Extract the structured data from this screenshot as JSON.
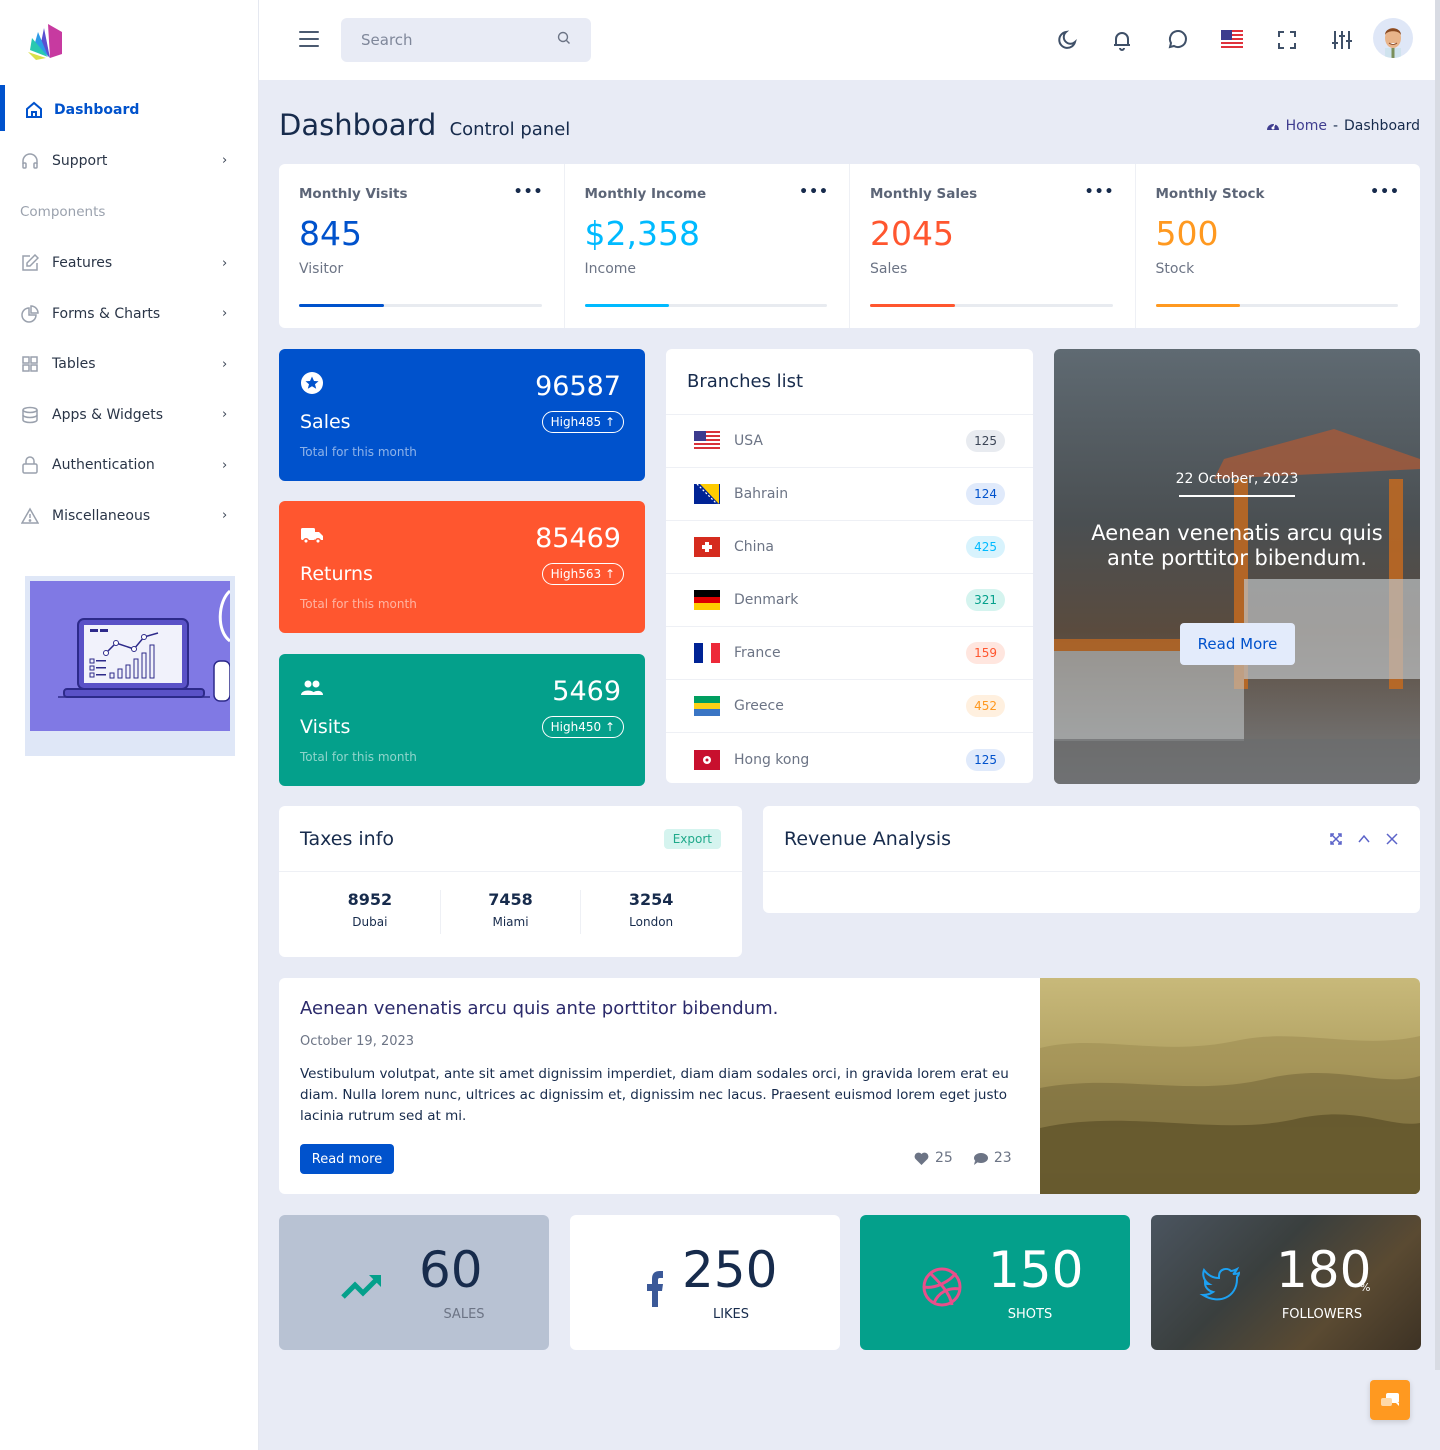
{
  "header": {
    "search_placeholder": "Search"
  },
  "sidebar": {
    "items": [
      {
        "label": "Dashboard",
        "active": true
      },
      {
        "label": "Support"
      },
      {
        "label": "Features"
      },
      {
        "label": "Forms & Charts"
      },
      {
        "label": "Tables"
      },
      {
        "label": "Apps & Widgets"
      },
      {
        "label": "Authentication"
      },
      {
        "label": "Miscellaneous"
      }
    ],
    "section_heading": "Components"
  },
  "page": {
    "title": "Dashboard",
    "subtitle": "Control panel",
    "breadcrumb": {
      "home": "Home",
      "separator": "-",
      "current": "Dashboard"
    }
  },
  "stats": [
    {
      "label": "Monthly Visits",
      "value": "845",
      "sub": "Visitor",
      "color": "#0052cc",
      "progress_pct": 35
    },
    {
      "label": "Monthly Income",
      "value": "$2,358",
      "sub": "Income",
      "color": "#00baff",
      "progress_pct": 35
    },
    {
      "label": "Monthly Sales",
      "value": "2045",
      "sub": "Sales",
      "color": "#ff562f",
      "progress_pct": 35
    },
    {
      "label": "Monthly Stock",
      "value": "500",
      "sub": "Stock",
      "color": "#ff9920",
      "progress_pct": 35
    }
  ],
  "stat_menu": "•••",
  "colored_cards": [
    {
      "title": "Sales",
      "value": "96587",
      "pill": "High485 ↑",
      "sub": "Total for this month",
      "color": "#0052cc"
    },
    {
      "title": "Returns",
      "value": "85469",
      "pill": "High563 ↑",
      "sub": "Total for this month",
      "color": "#ff562f"
    },
    {
      "title": "Visits",
      "value": "5469",
      "pill": "High450 ↑",
      "sub": "Total for this month",
      "color": "#04a08b"
    }
  ],
  "branches": {
    "title": "Branches list",
    "items": [
      {
        "name": "USA",
        "count": "125"
      },
      {
        "name": "Bahrain",
        "count": "124"
      },
      {
        "name": "China",
        "count": "425"
      },
      {
        "name": "Denmark",
        "count": "321"
      },
      {
        "name": "France",
        "count": "159"
      },
      {
        "name": "Greece",
        "count": "452"
      },
      {
        "name": "Hong kong",
        "count": "125"
      }
    ]
  },
  "feature": {
    "date": "22 October, 2023",
    "headline": "Aenean venenatis arcu quis ante porttitor bibendum.",
    "button": "Read More"
  },
  "taxes": {
    "title": "Taxes info",
    "export": "Export",
    "items": [
      {
        "value": "8952",
        "city": "Dubai"
      },
      {
        "value": "7458",
        "city": "Miami"
      },
      {
        "value": "3254",
        "city": "London"
      }
    ]
  },
  "revenue": {
    "title": "Revenue Analysis"
  },
  "blog": {
    "title": "Aenean venenatis arcu quis ante porttitor bibendum.",
    "date": "October 19, 2023",
    "body": "Vestibulum volutpat, ante sit amet dignissim imperdiet, diam diam sodales orci, in gravida lorem erat eu diam. Nulla lorem nunc, ultrices ac dignissim et, dignissim nec lacus. Praesent euismod lorem eget justo lacinia rutrum sed at mi.",
    "button": "Read more",
    "likes": "25",
    "comments": "23"
  },
  "social": [
    {
      "value": "60",
      "label": "SALES"
    },
    {
      "value": "250",
      "label": "LIKES"
    },
    {
      "value": "150",
      "label": "SHOTS"
    },
    {
      "value": "180",
      "suffix": "%",
      "label": "FOLLOWERS"
    }
  ]
}
